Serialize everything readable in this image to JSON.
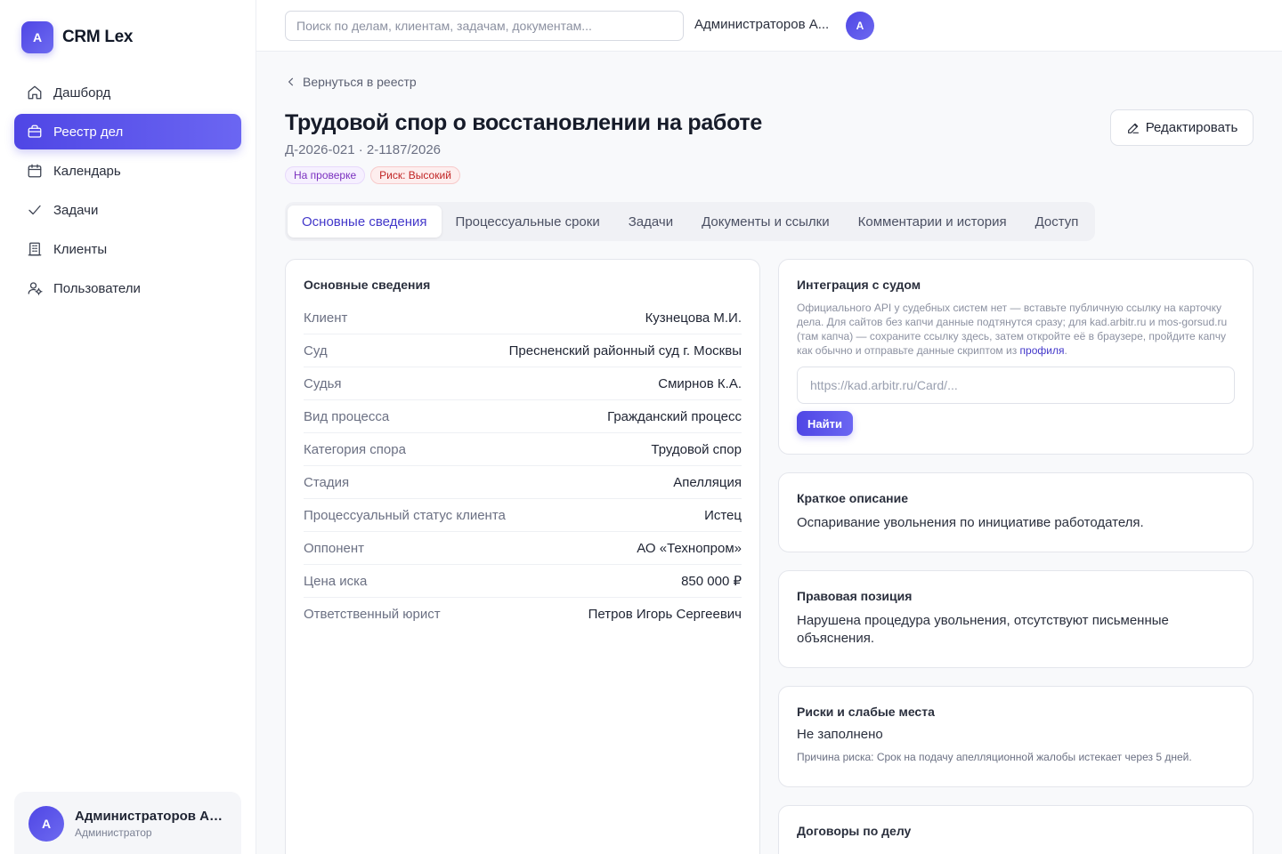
{
  "brand": {
    "logo_letter": "A",
    "name": "CRM Lex"
  },
  "sidebar": {
    "items": [
      {
        "label": "Дашборд",
        "icon": "home-icon",
        "active": false
      },
      {
        "label": "Реестр дел",
        "icon": "briefcase-icon",
        "active": true
      },
      {
        "label": "Календарь",
        "icon": "calendar-icon",
        "active": false
      },
      {
        "label": "Задачи",
        "icon": "check-icon",
        "active": false
      },
      {
        "label": "Клиенты",
        "icon": "building-icon",
        "active": false
      },
      {
        "label": "Пользователи",
        "icon": "users-gear-icon",
        "active": false
      }
    ],
    "user": {
      "avatar_letter": "A",
      "name": "Администраторов Ад...",
      "role": "Администратор"
    }
  },
  "header": {
    "search_placeholder": "Поиск по делам, клиентам, задачам, документам...",
    "user_name": "Администраторов А...",
    "avatar_letter": "A"
  },
  "page": {
    "back_label": "Вернуться в реестр",
    "title": "Трудовой спор о восстановлении на работе",
    "meta": "Д-2026-021 · 2-1187/2026",
    "badges": {
      "status": "На проверке",
      "risk": "Риск: Высокий"
    },
    "edit_label": "Редактировать",
    "tabs": [
      "Основные сведения",
      "Процессуальные сроки",
      "Задачи",
      "Документы и ссылки",
      "Комментарии и история",
      "Доступ"
    ],
    "active_tab": "Основные сведения"
  },
  "info": {
    "title": "Основные сведения",
    "rows": [
      {
        "label": "Клиент",
        "value": "Кузнецова М.И."
      },
      {
        "label": "Суд",
        "value": "Пресненский районный суд г. Москвы"
      },
      {
        "label": "Судья",
        "value": "Смирнов К.А."
      },
      {
        "label": "Вид процесса",
        "value": "Гражданский процесс"
      },
      {
        "label": "Категория спора",
        "value": "Трудовой спор"
      },
      {
        "label": "Стадия",
        "value": "Апелляция"
      },
      {
        "label": "Процессуальный статус клиента",
        "value": "Истец"
      },
      {
        "label": "Оппонент",
        "value": "АО «Технопром»"
      },
      {
        "label": "Цена иска",
        "value": "850 000 ₽"
      },
      {
        "label": "Ответственный юрист",
        "value": "Петров Игорь Сергеевич"
      }
    ]
  },
  "court": {
    "title": "Интеграция с судом",
    "description": "Официального API у судебных систем нет — вставьте публичную ссылку на карточку дела. Для сайтов без капчи данные подтянутся сразу; для kad.arbitr.ru и mos-gorsud.ru (там капча) — сохраните ссылку здесь, затем откройте её в браузере, пройдите капчу как обычно и отправьте данные скриптом из",
    "link_text": "профиля",
    "input_placeholder": "https://kad.arbitr.ru/Card/...",
    "find_label": "Найти"
  },
  "summary": {
    "title": "Краткое описание",
    "text": "Оспаривание увольнения по инициативе работодателя."
  },
  "position": {
    "title": "Правовая позиция",
    "text": "Нарушена процедура увольнения, отсутствуют письменные объяснения."
  },
  "risks": {
    "title": "Риски и слабые места",
    "text": "Не заполнено",
    "note": "Причина риска: Срок на подачу апелляционной жалобы истекает через 5 дней."
  },
  "contracts": {
    "title": "Договоры по делу"
  }
}
